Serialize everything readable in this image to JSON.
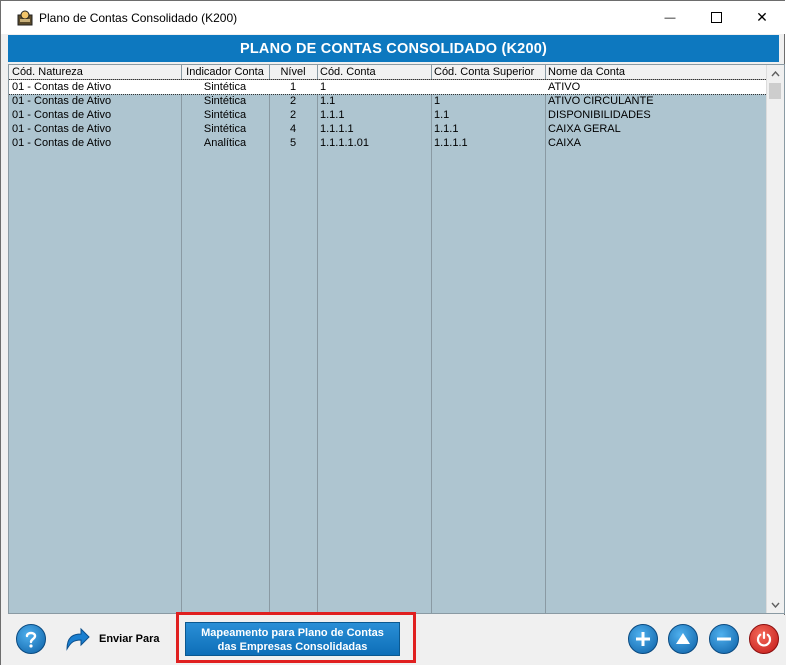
{
  "window": {
    "title": "Plano de Contas Consolidado (K200)",
    "minimize_glyph": "—",
    "close_glyph": "✕"
  },
  "header": {
    "title": "PLANO DE CONTAS CONSOLIDADO (K200)"
  },
  "grid": {
    "columns": [
      "Cód. Natureza",
      "Indicador Conta",
      "Nível",
      "Cód. Conta",
      "Cód. Conta Superior",
      "Nome da Conta"
    ],
    "rows": [
      [
        "01 - Contas de Ativo",
        "Sintética",
        "1",
        "1",
        "",
        "ATIVO"
      ],
      [
        "01 - Contas de Ativo",
        "Sintética",
        "2",
        "1.1",
        "1",
        "ATIVO CIRCULANTE"
      ],
      [
        "01 - Contas de Ativo",
        "Sintética",
        "2",
        "1.1.1",
        "1.1",
        "DISPONIBILIDADES"
      ],
      [
        "01 - Contas de Ativo",
        "Sintética",
        "4",
        "1.1.1.1",
        "1.1.1",
        "CAIXA GERAL"
      ],
      [
        "01 - Contas de Ativo",
        "Analítica",
        "5",
        "1.1.1.1.01",
        "1.1.1.1",
        "CAIXA"
      ]
    ]
  },
  "footer": {
    "send_label": "Enviar Para",
    "map_button_line1": "Mapeamento para Plano de Contas",
    "map_button_line2": "das Empresas Consolidadas"
  },
  "colors": {
    "accent": "#0d78bf",
    "grid_bg": "#aec5d0",
    "highlight": "#e02020"
  },
  "icons": {
    "help": "help-icon",
    "send": "share-arrow-icon",
    "add": "plus-icon",
    "up": "up-arrow-icon",
    "remove": "minus-icon",
    "exit": "power-icon"
  }
}
